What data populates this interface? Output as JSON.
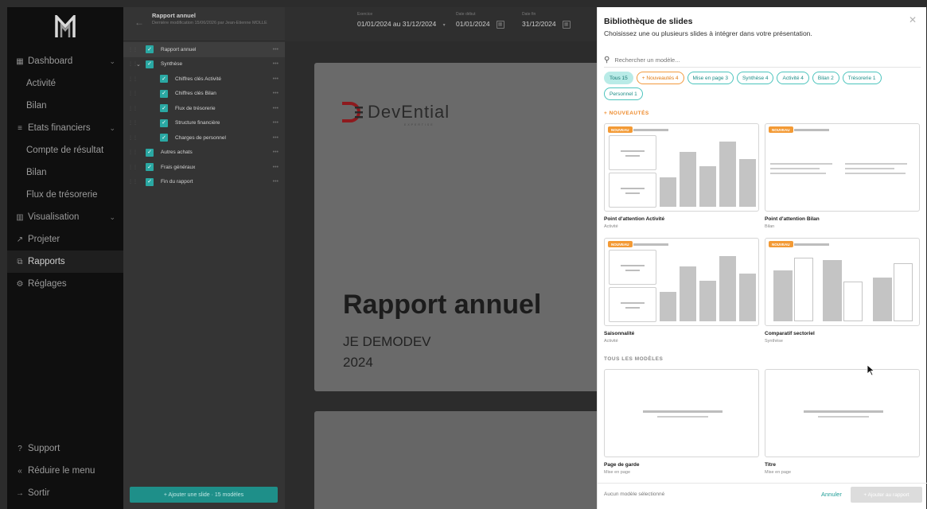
{
  "sidebar": {
    "nav": [
      {
        "label": "Dashboard",
        "icon": "dashboard-icon",
        "glyph": "▦",
        "chevron": true,
        "sub": false,
        "active": false
      },
      {
        "label": "Activité",
        "sub": true
      },
      {
        "label": "Bilan",
        "sub": true
      },
      {
        "label": "Etats financiers",
        "icon": "list-icon",
        "glyph": "≡",
        "chevron": true,
        "sub": false
      },
      {
        "label": "Compte de résultat",
        "sub": true
      },
      {
        "label": "Bilan",
        "sub": true
      },
      {
        "label": "Flux de trésorerie",
        "sub": true
      },
      {
        "label": "Visualisation",
        "icon": "chart-icon",
        "glyph": "▥",
        "chevron": true,
        "sub": false
      },
      {
        "label": "Projeter",
        "icon": "trend-icon",
        "glyph": "↗",
        "chevron": false,
        "sub": false
      },
      {
        "label": "Rapports",
        "icon": "report-icon",
        "glyph": "⧉",
        "chevron": false,
        "sub": false,
        "active": true
      },
      {
        "label": "Réglages",
        "icon": "settings-icon",
        "glyph": "⚙",
        "chevron": false,
        "sub": false
      }
    ],
    "bottom": [
      {
        "label": "Support",
        "icon": "help-icon",
        "glyph": "?"
      },
      {
        "label": "Réduire le menu",
        "icon": "collapse-icon",
        "glyph": "«"
      },
      {
        "label": "Sortir",
        "icon": "logout-icon",
        "glyph": "→"
      }
    ]
  },
  "outline": {
    "title": "Rapport annuel",
    "subtitle": "Dernière modification 15/06/2026 par Jean-Etienne MOLLE",
    "items": [
      {
        "label": "Rapport annuel",
        "level": 0,
        "selected": true,
        "caret": false
      },
      {
        "label": "Synthèse",
        "level": 0,
        "caret": true
      },
      {
        "label": "Chiffres clés Activité",
        "level": 1
      },
      {
        "label": "Chiffres clés Bilan",
        "level": 1
      },
      {
        "label": "Flux de trésorerie",
        "level": 1
      },
      {
        "label": "Structure financière",
        "level": 1
      },
      {
        "label": "Charges de personnel",
        "level": 1
      },
      {
        "label": "Autres achats",
        "level": 0
      },
      {
        "label": "Frais généraux",
        "level": 0
      },
      {
        "label": "Fin du rapport",
        "level": 0
      }
    ],
    "add_button": "+ Ajouter une slide · 15 modèles"
  },
  "topbar": {
    "exercise_label": "Exercice",
    "exercise_value": "01/01/2024 au 31/12/2024",
    "start_label": "Date début",
    "start_value": "01/01/2024",
    "end_label": "Date fin",
    "end_value": "31/12/2024"
  },
  "slide": {
    "brand": "DevEntial",
    "brand_tag": "EXPERTISE",
    "title": "Rapport annuel",
    "company": "JE DEMODEV",
    "year": "2024"
  },
  "library": {
    "title": "Bibliothèque de slides",
    "subtitle": "Choisissez une ou plusieurs slides à intégrer dans votre présentation.",
    "search_placeholder": "Rechercher un modèle...",
    "chips": [
      {
        "label": "Tous 15",
        "style": "active"
      },
      {
        "label": "+ Nouveautés 4",
        "style": "orange"
      },
      {
        "label": "Mise en page 3",
        "style": ""
      },
      {
        "label": "Synthèse 4",
        "style": ""
      },
      {
        "label": "Activité 4",
        "style": ""
      },
      {
        "label": "Bilan 2",
        "style": ""
      },
      {
        "label": "Trésorerie 1",
        "style": ""
      },
      {
        "label": "Personnel 1",
        "style": ""
      }
    ],
    "section_new": "+ NOUVEAUTÉS",
    "section_all": "TOUS LES MODÈLES",
    "badge": "NOUVEAU",
    "cards": [
      {
        "name": "Point d'attention Activité",
        "category": "Activité"
      },
      {
        "name": "Point d'attention Bilan",
        "category": "Bilan"
      },
      {
        "name": "Saisonnalité",
        "category": "Activité"
      },
      {
        "name": "Comparatif sectoriel",
        "category": "Synthèse"
      },
      {
        "name": "Page de garde",
        "category": "Mise en page"
      },
      {
        "name": "Titre",
        "category": "Mise en page"
      }
    ],
    "footer_status": "Aucun modèle sélectionné",
    "cancel": "Annuler",
    "add": "+ Ajouter au rapport"
  },
  "colors": {
    "accent": "#1e8f89",
    "new_badge": "#f39a35",
    "brand_red": "#b3181e"
  }
}
